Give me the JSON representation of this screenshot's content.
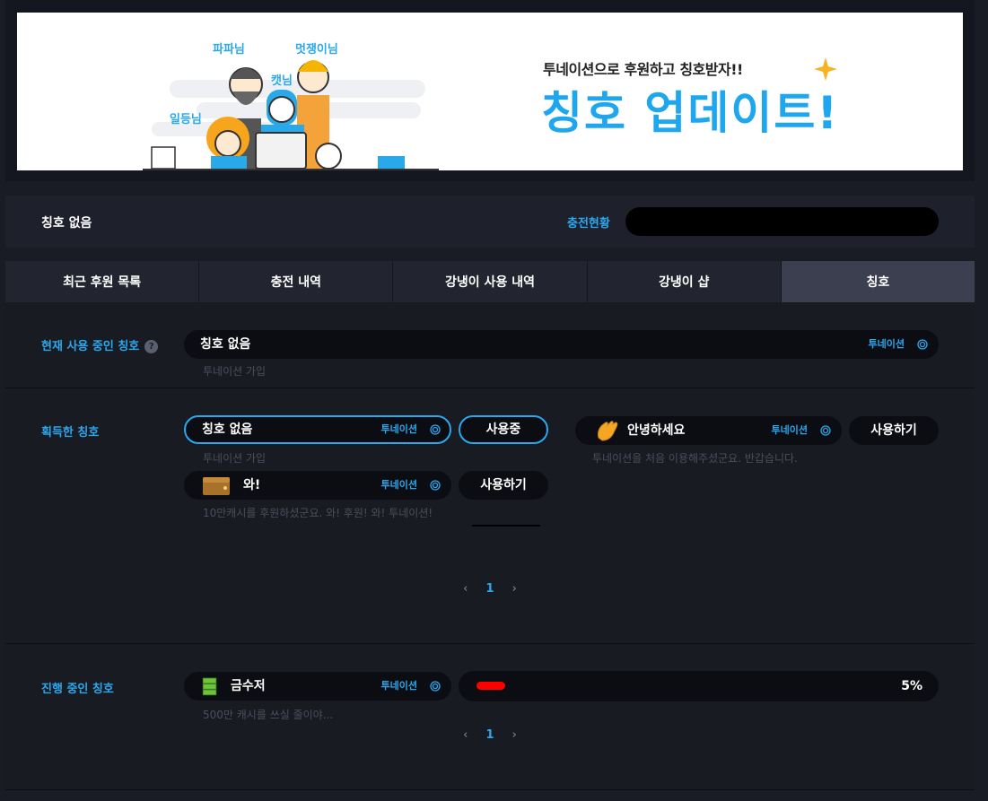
{
  "banner": {
    "subtitle": "투네이션으로 후원하고 칭호받자!!",
    "title": "칭호 업데이트!",
    "names": [
      "파파님",
      "멋쟁이님",
      "캣님",
      "일등님"
    ],
    "accent_color": "#1ea7ee"
  },
  "status": {
    "current_title": "칭호 없음",
    "charge_label": "충전현황"
  },
  "tabs": [
    {
      "label": "최근 후원 목록"
    },
    {
      "label": "충전 내역"
    },
    {
      "label": "강냉이 사용 내역"
    },
    {
      "label": "강냉이 샵"
    },
    {
      "label": "칭호"
    }
  ],
  "current": {
    "label": "현재 사용 중인 칭호",
    "help": "?",
    "title": "칭호 없음",
    "tag": "투네이션",
    "desc": "투네이션 가입"
  },
  "acquired": {
    "label": "획득한 칭호",
    "items": [
      {
        "title": "칭호 없음",
        "tag": "투네이션",
        "desc": "투네이션 가입",
        "button": "사용중"
      },
      {
        "title": "안녕하세요",
        "tag": "투네이션",
        "desc": "투네이션을 처음 이용해주셨군요. 반갑습니다.",
        "button": "사용하기"
      },
      {
        "title": "와!",
        "tag": "투네이션",
        "desc": "10만캐시를 후원하셨군요. 와! 후원! 와! 투네이션!",
        "button": "사용하기"
      }
    ],
    "pager": {
      "prev": "‹",
      "page": "1",
      "next": "›"
    }
  },
  "progress": {
    "label": "진행 중인 칭호",
    "title": "금수저",
    "tag": "투네이션",
    "desc": "500만 캐시를 쓰실 줄이야...",
    "percent": 5,
    "percent_label": "5%",
    "bar_color": "#ff0000",
    "pager": {
      "prev": "‹",
      "page": "1",
      "next": "›"
    }
  }
}
